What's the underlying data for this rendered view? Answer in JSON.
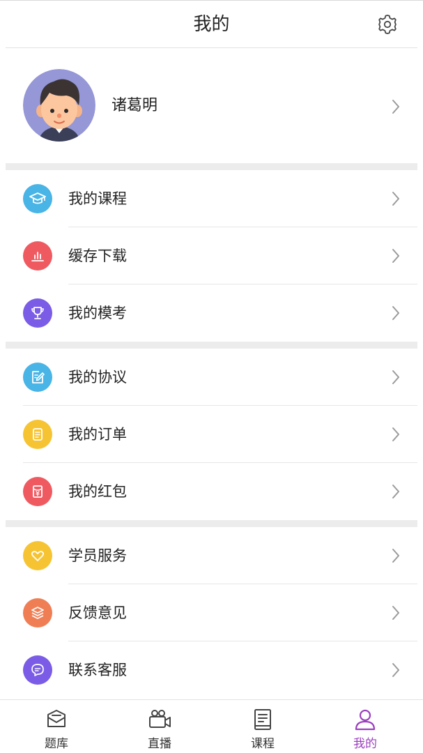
{
  "header": {
    "title": "我的",
    "settings_icon": "gear-icon"
  },
  "profile": {
    "name": "诸葛明",
    "avatar": "avatar-boy-illustration"
  },
  "menu": {
    "group1": [
      {
        "label": "我的课程",
        "icon": "graduation-cap-icon",
        "color": "#49b4e6"
      },
      {
        "label": "缓存下载",
        "icon": "bar-chart-icon",
        "color": "#ef5a61"
      },
      {
        "label": "我的模考",
        "icon": "trophy-icon",
        "color": "#7a5ce6"
      }
    ],
    "group2": [
      {
        "label": "我的协议",
        "icon": "edit-document-icon",
        "color": "#49b4e6"
      },
      {
        "label": "我的订单",
        "icon": "order-list-icon",
        "color": "#f6c433"
      },
      {
        "label": "我的红包",
        "icon": "red-envelope-icon",
        "color": "#ef5a61"
      }
    ],
    "group3": [
      {
        "label": "学员服务",
        "icon": "heart-icon",
        "color": "#f6c433"
      },
      {
        "label": "反馈意见",
        "icon": "stack-icon",
        "color": "#ef7e55"
      },
      {
        "label": "联系客服",
        "icon": "chat-bubble-icon",
        "color": "#7a5ce6"
      }
    ]
  },
  "tabbar": {
    "tabs": [
      {
        "label": "题库",
        "icon": "question-bank-icon"
      },
      {
        "label": "直播",
        "icon": "video-camera-icon"
      },
      {
        "label": "课程",
        "icon": "course-book-icon"
      },
      {
        "label": "我的",
        "icon": "user-profile-icon"
      }
    ],
    "active_index": 3,
    "active_color": "#9b3fbf"
  }
}
